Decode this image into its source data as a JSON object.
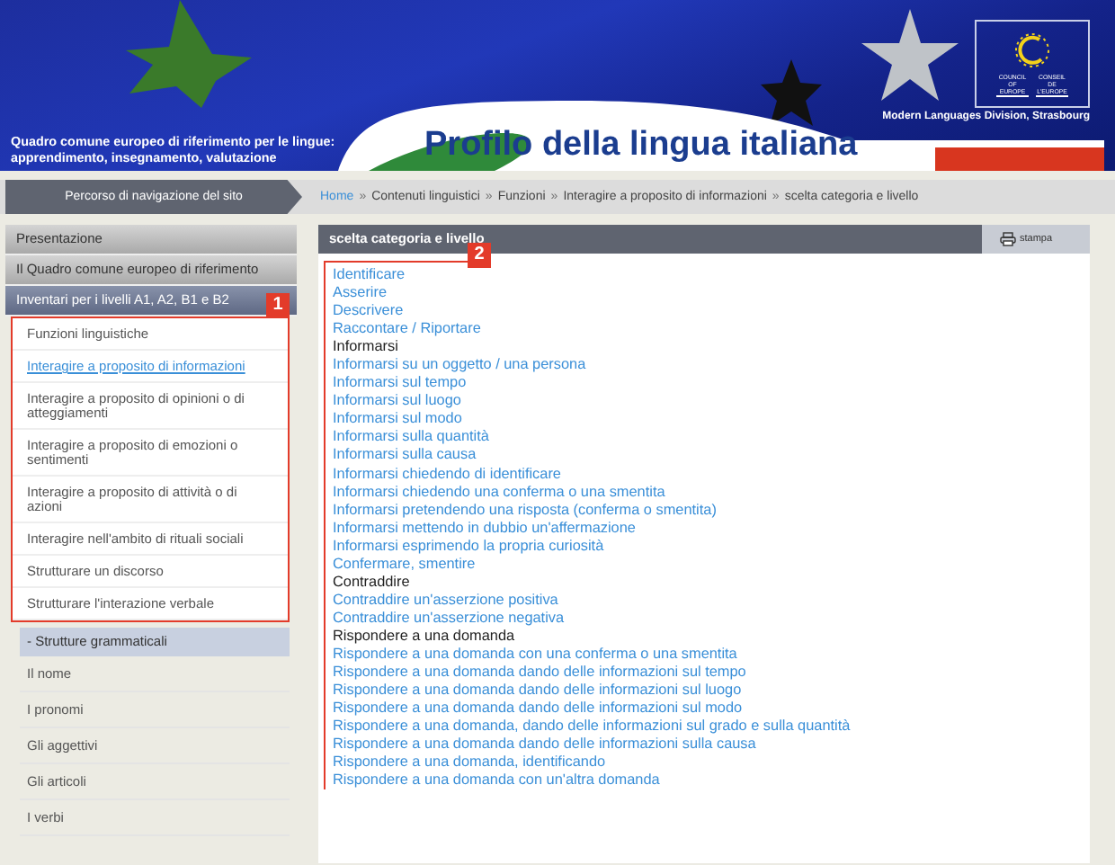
{
  "banner": {
    "subtitle_lines": [
      "Quadro comune europeo di riferimento per le lingue:",
      "apprendimento, insegnamento, valutazione"
    ],
    "title": "Profilo della lingua italiana",
    "logo_left": "COUNCIL OF EUROPE",
    "logo_right": "CONSEIL DE L'EUROPE",
    "division": "Modern Languages Division, Strasbourg"
  },
  "breadcrumb": {
    "label": "Percorso di navigazione del sito",
    "separator": "»",
    "crumbs": [
      {
        "text": "Home",
        "kind": "link"
      },
      {
        "text": "Contenuti linguistici",
        "kind": "text"
      },
      {
        "text": "Funzioni",
        "kind": "text"
      },
      {
        "text": "Interagire a proposito di informazioni",
        "kind": "text"
      },
      {
        "text": "scelta categoria e livello",
        "kind": "text"
      }
    ]
  },
  "sidebar": {
    "top_items": [
      {
        "label": "Presentazione",
        "selected": false
      },
      {
        "label": "Il Quadro comune europeo di riferimento",
        "selected": false
      },
      {
        "label": "Inventari per i livelli A1, A2, B1 e B2",
        "selected": true
      }
    ],
    "annotation": "1",
    "sub_items": [
      {
        "label": "Funzioni linguistiche",
        "selected": false
      },
      {
        "label": "Interagire a proposito di informazioni",
        "selected": true
      },
      {
        "label": "Interagire a proposito di opinioni o di atteggiamenti",
        "selected": false
      },
      {
        "label": "Interagire a proposito di emozioni o sentimenti",
        "selected": false
      },
      {
        "label": "Interagire a proposito di attività o di azioni",
        "selected": false
      },
      {
        "label": "Interagire nell'ambito di rituali sociali",
        "selected": false
      },
      {
        "label": "Strutturare un discorso",
        "selected": false
      },
      {
        "label": "Strutturare l'interazione verbale",
        "selected": false
      }
    ],
    "section": "- Strutture grammaticali",
    "section_items": [
      "Il nome",
      "I pronomi",
      "Gli aggettivi",
      "Gli articoli",
      "I verbi"
    ]
  },
  "content": {
    "title": "scelta categoria e livello",
    "print_label": "stampa",
    "annotation": "2",
    "items": [
      {
        "text": "Identificare",
        "kind": "link"
      },
      {
        "text": "Asserire",
        "kind": "link"
      },
      {
        "text": "Descrivere",
        "kind": "link"
      },
      {
        "text": "Raccontare / Riportare",
        "kind": "link"
      },
      {
        "text": "Informarsi",
        "kind": "heading"
      },
      {
        "text": "Informarsi su un oggetto / una persona",
        "kind": "link"
      },
      {
        "text": "Informarsi sul tempo",
        "kind": "link"
      },
      {
        "text": "Informarsi sul luogo",
        "kind": "link"
      },
      {
        "text": "Informarsi sul modo",
        "kind": "link"
      },
      {
        "text": "Informarsi sulla quantità",
        "kind": "link"
      },
      {
        "text": "Informarsi sulla causa",
        "kind": "link"
      },
      {
        "text": "Informarsi chiedendo di identificare",
        "kind": "link"
      },
      {
        "text": "Informarsi chiedendo una conferma o una smentita",
        "kind": "link"
      },
      {
        "text": "Informarsi pretendendo una risposta (conferma o smentita)",
        "kind": "link"
      },
      {
        "text": "Informarsi mettendo in dubbio un'affermazione",
        "kind": "link"
      },
      {
        "text": "Informarsi esprimendo la propria curiosità",
        "kind": "link"
      },
      {
        "text": "Confermare, smentire",
        "kind": "link"
      },
      {
        "text": "Contraddire",
        "kind": "heading"
      },
      {
        "text": "Contraddire un'asserzione positiva",
        "kind": "link"
      },
      {
        "text": "Contraddire un'asserzione negativa",
        "kind": "link"
      },
      {
        "text": "Rispondere a una domanda",
        "kind": "heading"
      },
      {
        "text": "Rispondere a una domanda con una conferma o una smentita",
        "kind": "link"
      },
      {
        "text": "Rispondere a una domanda dando delle informazioni sul tempo",
        "kind": "link"
      },
      {
        "text": "Rispondere a una domanda dando delle informazioni sul luogo",
        "kind": "link"
      },
      {
        "text": "Rispondere a una domanda dando delle informazioni sul modo",
        "kind": "link"
      },
      {
        "text": "Rispondere a una domanda, dando delle informazioni sul grado e sulla quantità",
        "kind": "link"
      },
      {
        "text": "Rispondere a una domanda dando delle informazioni sulla causa",
        "kind": "link"
      },
      {
        "text": "Rispondere a una domanda, identificando",
        "kind": "link"
      },
      {
        "text": "Rispondere a una domanda con un'altra domanda",
        "kind": "link"
      }
    ]
  }
}
